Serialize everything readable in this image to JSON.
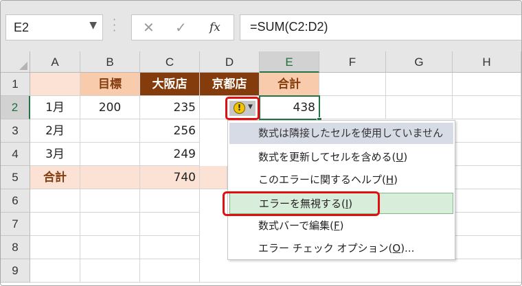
{
  "name_box": {
    "value": "E2"
  },
  "formula_bar": {
    "value": "=SUM(C2:D2)",
    "fx_label": "fx"
  },
  "columns": [
    "A",
    "B",
    "C",
    "D",
    "E",
    "F",
    "G",
    "H"
  ],
  "rows": [
    "1",
    "2",
    "3",
    "4",
    "5",
    "6",
    "7",
    "8",
    "9"
  ],
  "cells": {
    "B1": "目標",
    "C1": "大阪店",
    "D1": "京都店",
    "E1": "合計",
    "A2": "1月",
    "B2": "200",
    "C2": "235",
    "E2": "438",
    "A3": "2月",
    "C3": "256",
    "A4": "3月",
    "C4": "249",
    "A5": "合計",
    "C5": "740"
  },
  "error_menu": {
    "header": "数式は隣接したセルを使用していません",
    "items": [
      {
        "text": "数式を更新してセルを含める(",
        "key": "U",
        "suffix": ")"
      },
      {
        "text": "このエラーに関するヘルプ(",
        "key": "H",
        "suffix": ")"
      },
      {
        "text": "エラーを無視する(",
        "key": "I",
        "suffix": ")"
      },
      {
        "text": "数式バーで編集(",
        "key": "F",
        "suffix": ")"
      },
      {
        "text": "エラー チェック オプション(",
        "key": "O",
        "suffix": ")..."
      }
    ]
  },
  "colors": {
    "brown": "#843c0c",
    "tan": "#f8cbad",
    "light_tan": "#fbe2d5",
    "excel_green": "#217346",
    "highlight_red": "#e01010"
  }
}
